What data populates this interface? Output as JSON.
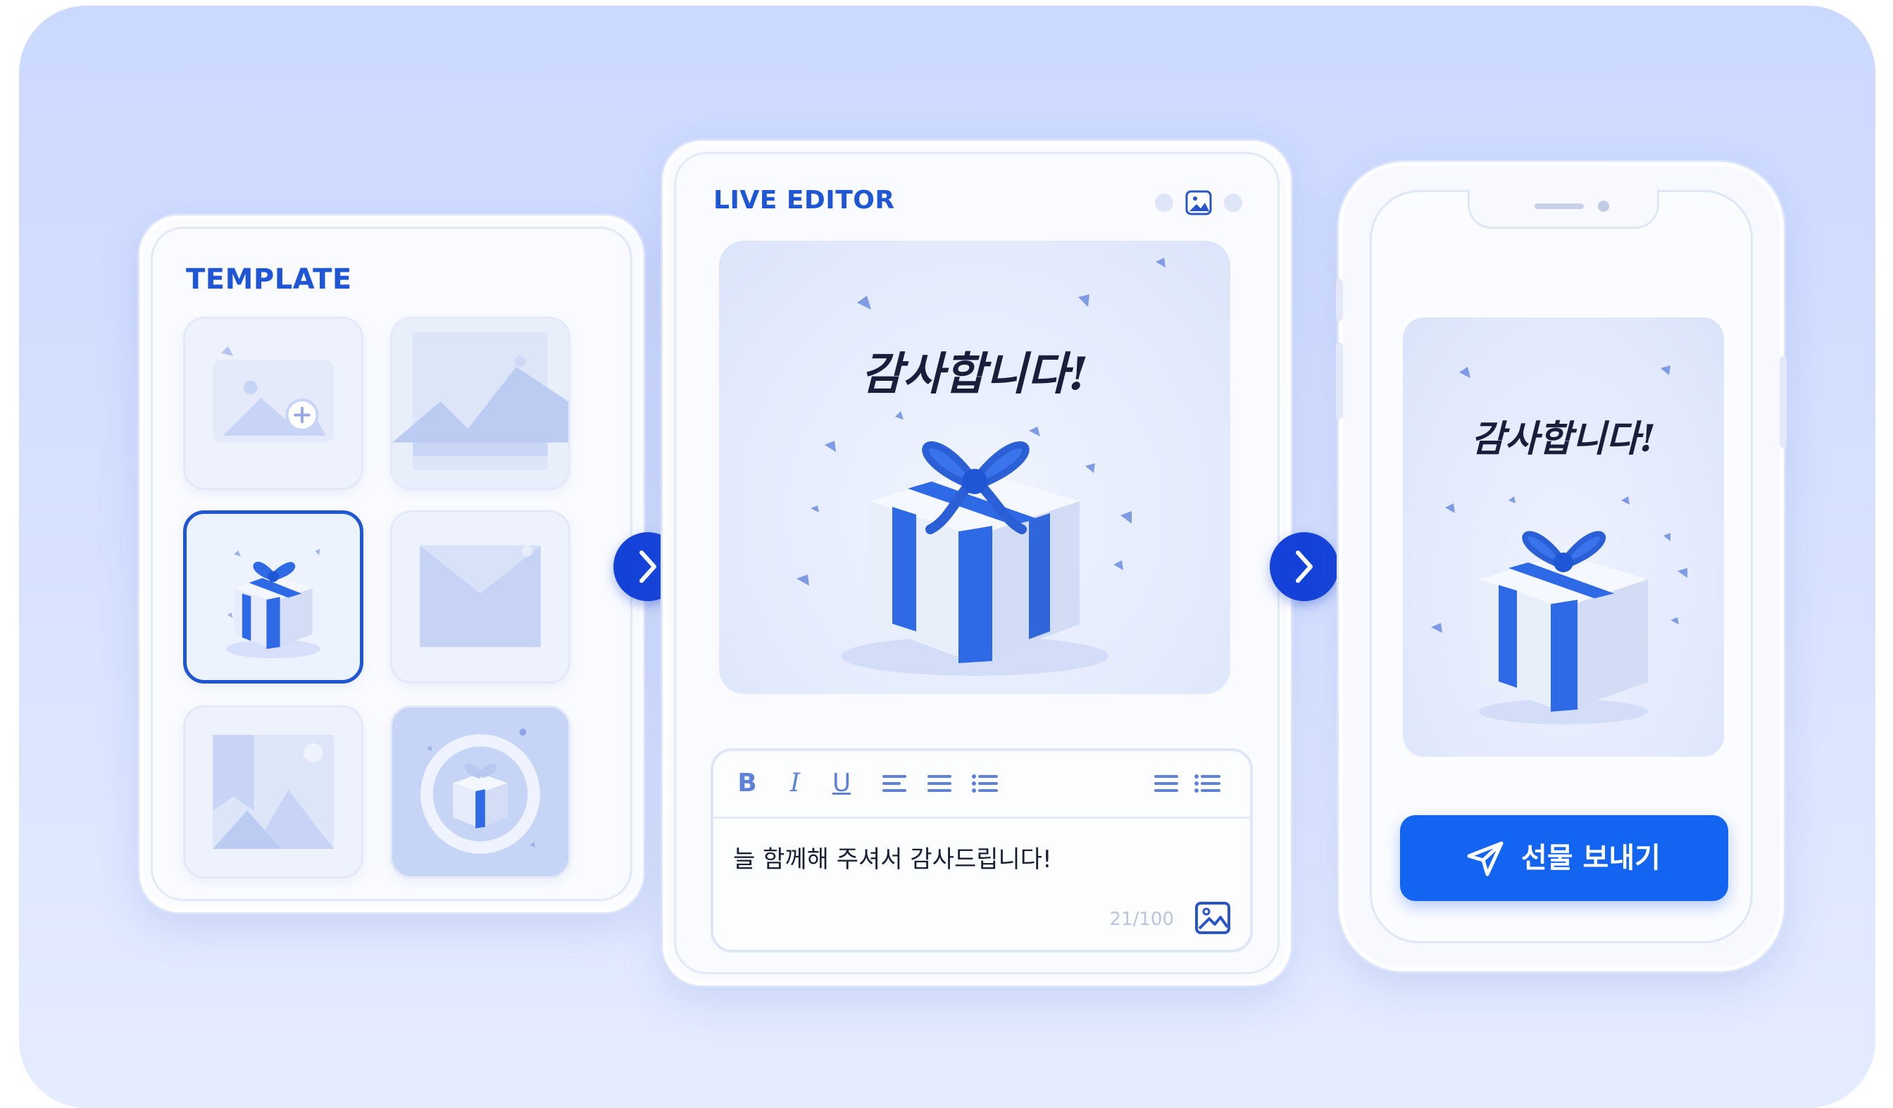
{
  "template": {
    "title": "TEMPLATE",
    "selected_index": 2
  },
  "editor": {
    "title": "LIVE EDITOR",
    "card_heading": "감사합니다!",
    "toolbar": [
      "B",
      "I",
      "U"
    ],
    "message": "늘 함께해 주셔서 감사드립니다!",
    "counter": "21/100"
  },
  "preview": {
    "card_heading": "감사합니다!",
    "send_label": "선물 보내기"
  },
  "colors": {
    "accent": "#1f56d6",
    "arrow": "#1442d9",
    "send_button": "#1464f2",
    "background": "#d4dfff"
  }
}
